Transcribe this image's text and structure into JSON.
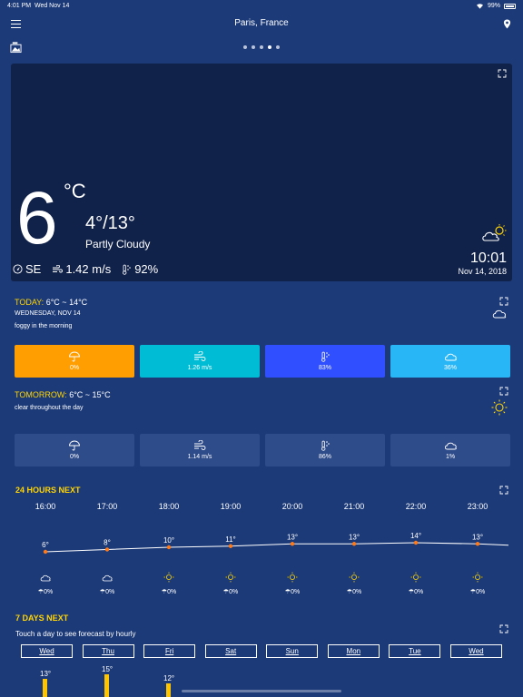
{
  "status": {
    "time": "4:01 PM",
    "date": "Wed Nov 14",
    "battery": "99%"
  },
  "header": {
    "city": "Paris, France"
  },
  "pages": {
    "count": 5,
    "active": 3
  },
  "hero": {
    "temp": "6",
    "unit": "°C",
    "range": "4°/13°",
    "condition": "Partly Cloudy",
    "wind_dir": "SE",
    "wind_speed": "1.42 m/s",
    "humidity": "92%",
    "time": "10:01",
    "date": "Nov 14, 2018"
  },
  "today": {
    "label": "TODAY:",
    "range": "6°C ~ 14°C",
    "date": "WEDNESDAY, NOV 14",
    "summary": "foggy in the morning",
    "tiles": [
      "0%",
      "1.26 m/s",
      "83%",
      "36%"
    ]
  },
  "tomorrow": {
    "label": "TOMORROW:",
    "range": "6°C ~ 15°C",
    "summary": "clear throughout the day",
    "tiles": [
      "0%",
      "1.14 m/s",
      "86%",
      "1%"
    ]
  },
  "hours": {
    "title": "24 HOURS NEXT",
    "times": [
      "16:00",
      "17:00",
      "18:00",
      "19:00",
      "20:00",
      "21:00",
      "22:00",
      "23:00"
    ],
    "temps": [
      "6°",
      "8°",
      "10°",
      "11°",
      "13°",
      "13°",
      "14°",
      "13°"
    ],
    "icons": [
      "cloud-icon",
      "cloud-icon",
      "sun-icon",
      "sun-icon",
      "sun-icon",
      "sun-icon",
      "sun-icon",
      "sun-icon"
    ],
    "precip": [
      "0%",
      "0%",
      "0%",
      "0%",
      "0%",
      "0%",
      "0%",
      "0%"
    ]
  },
  "chart_data": {
    "type": "line",
    "x": [
      "16:00",
      "17:00",
      "18:00",
      "19:00",
      "20:00",
      "21:00",
      "22:00",
      "23:00"
    ],
    "series": [
      {
        "values": [
          6,
          8,
          10,
          11,
          13,
          13,
          14,
          13
        ]
      }
    ]
  },
  "days": {
    "title": "7 DAYS NEXT",
    "hint": "Touch a day to see forecast by hourly",
    "names": [
      "Wed",
      "Thu",
      "Fri",
      "Sat",
      "Sun",
      "Mon",
      "Tue",
      "Wed"
    ],
    "partial_highs": [
      "13°",
      "15°",
      "12°"
    ]
  },
  "colors": {
    "accent_yellow": "#ffd400",
    "point_orange": "#ff7a1a",
    "background": "#1c3a78"
  }
}
